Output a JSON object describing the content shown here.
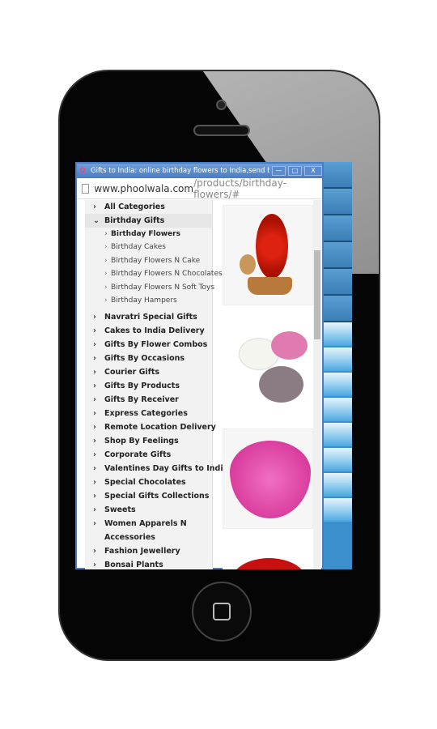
{
  "window": {
    "title": "Gifts to India: online birthday flowers to India,send bi...",
    "minimize": "—",
    "maximize": "□",
    "close": "X"
  },
  "address": {
    "host": "www.phoolwala.com",
    "path": "/products/birthday-flowers/#"
  },
  "menu": {
    "top": [
      {
        "label": "All Categories"
      },
      {
        "label": "Birthday Gifts"
      }
    ],
    "sub": [
      {
        "label": "Birthday Flowers"
      },
      {
        "label": "Birthday Cakes"
      },
      {
        "label": "Birthday Flowers N Cake"
      },
      {
        "label": "Birthday Flowers N Chocolates"
      },
      {
        "label": "Birthday Flowers N Soft Toys"
      },
      {
        "label": "Birthday Hampers"
      }
    ],
    "items": [
      {
        "label": "Navratri Special Gifts"
      },
      {
        "label": "Cakes to India Delivery"
      },
      {
        "label": "Gifts By Flower Combos"
      },
      {
        "label": "Gifts By Occasions"
      },
      {
        "label": "Courier Gifts"
      },
      {
        "label": "Gifts By Products"
      },
      {
        "label": "Gifts By Receiver"
      },
      {
        "label": "Express Categories"
      },
      {
        "label": "Remote Location Delivery"
      },
      {
        "label": "Shop By Feelings"
      },
      {
        "label": "Corporate Gifts"
      },
      {
        "label": "Valentines Day Gifts to India"
      },
      {
        "label": "Special Chocolates"
      },
      {
        "label": "Special Gifts Collections"
      },
      {
        "label": "Sweets"
      },
      {
        "label": "Women Apparels N"
      },
      {
        "label": "Accessories"
      },
      {
        "label": "Fashion Jewellery"
      },
      {
        "label": "Bonsai Plants"
      }
    ]
  },
  "products": [
    {
      "icon": "red-roses-basket-with-teddy"
    },
    {
      "icon": "pink-white-lilies-bouquet"
    },
    {
      "icon": "pink-roses-heart"
    },
    {
      "icon": "red-roses-arrangement"
    }
  ]
}
